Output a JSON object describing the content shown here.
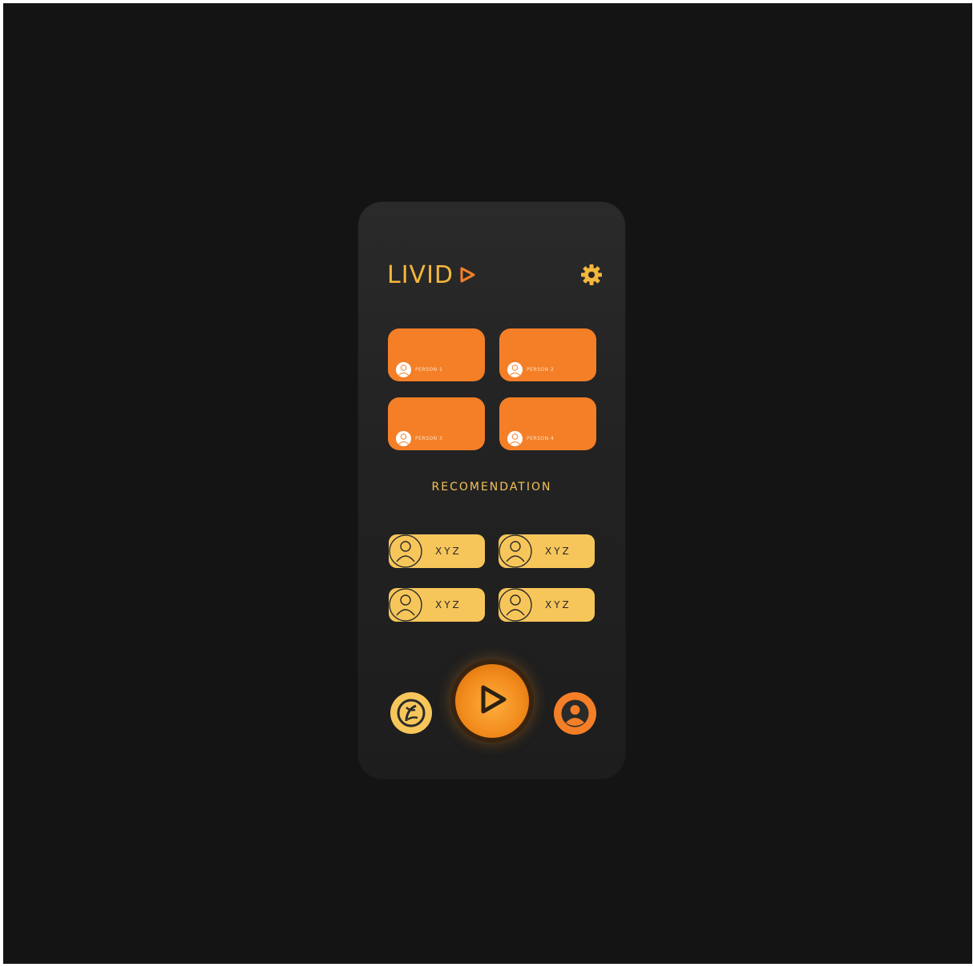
{
  "app": {
    "logo_text": "LIVID",
    "logo_icon": "play-icon",
    "settings_icon": "gear-icon"
  },
  "video_grid": [
    {
      "name": "PERSON 1"
    },
    {
      "name": "PERSON 2"
    },
    {
      "name": "PERSON 3"
    },
    {
      "name": "PERSON 4"
    }
  ],
  "recommendation": {
    "title": "RECOMENDATION",
    "items": [
      {
        "label": "XYZ"
      },
      {
        "label": "XYZ"
      },
      {
        "label": "XYZ"
      },
      {
        "label": "XYZ"
      }
    ]
  },
  "bottom_nav": {
    "left_icon": "compass-icon",
    "center_icon": "play-icon",
    "right_icon": "profile-icon"
  },
  "colors": {
    "background": "#141414",
    "phone": "#262626",
    "orange": "#f47f27",
    "yellow": "#f7c65a",
    "gold_text": "#f5b63c"
  }
}
